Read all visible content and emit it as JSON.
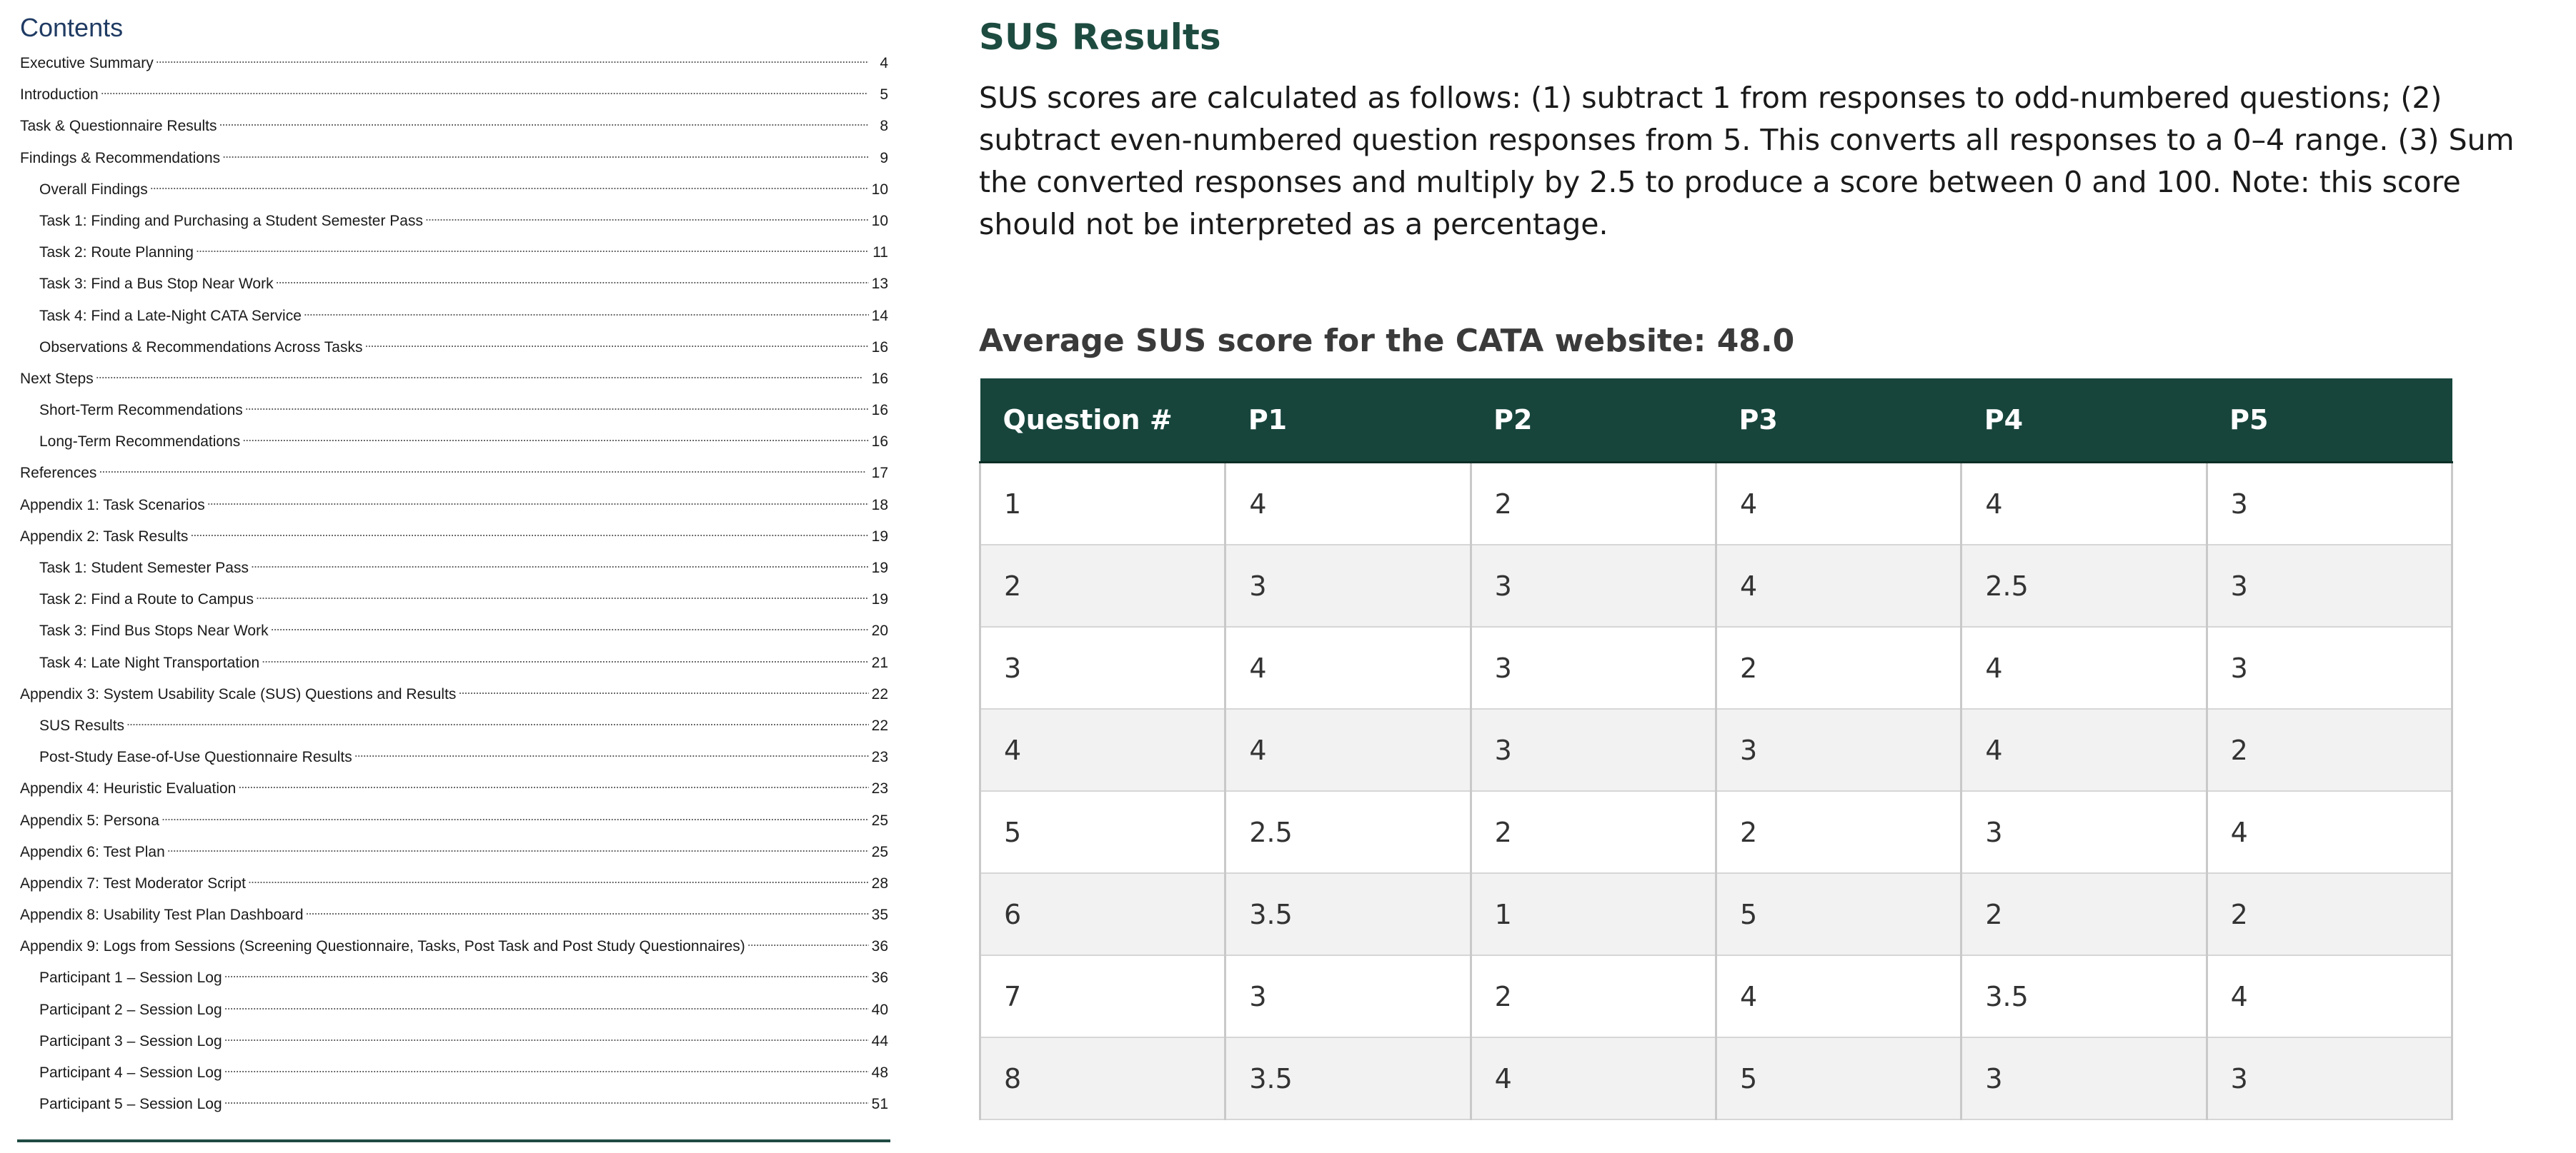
{
  "toc": {
    "heading": "Contents",
    "entries": [
      {
        "title": "Executive Summary",
        "page": "4",
        "level": 1
      },
      {
        "title": "Introduction",
        "page": "5",
        "level": 1
      },
      {
        "title": "Task & Questionnaire Results",
        "page": "8",
        "level": 1
      },
      {
        "title": "Findings & Recommendations",
        "page": "9",
        "level": 1
      },
      {
        "title": "Overall Findings",
        "page": "10",
        "level": 2
      },
      {
        "title": "Task 1: Finding and Purchasing a Student Semester Pass",
        "page": "10",
        "level": 2
      },
      {
        "title": "Task 2: Route Planning",
        "page": "11",
        "level": 2
      },
      {
        "title": "Task 3: Find a Bus Stop Near Work",
        "page": "13",
        "level": 2
      },
      {
        "title": "Task 4: Find a Late-Night CATA Service",
        "page": "14",
        "level": 2
      },
      {
        "title": "Observations & Recommendations Across Tasks",
        "page": "16",
        "level": 2
      },
      {
        "title": "Next Steps",
        "page": "16",
        "level": 1
      },
      {
        "title": "Short-Term Recommendations",
        "page": "16",
        "level": 2
      },
      {
        "title": "Long-Term Recommendations",
        "page": "16",
        "level": 2
      },
      {
        "title": "References",
        "page": "17",
        "level": 1
      },
      {
        "title": "Appendix 1: Task Scenarios",
        "page": "18",
        "level": 1
      },
      {
        "title": "Appendix 2: Task Results",
        "page": "19",
        "level": 1
      },
      {
        "title": "Task 1: Student Semester Pass",
        "page": "19",
        "level": 2
      },
      {
        "title": "Task 2: Find a Route to Campus",
        "page": "19",
        "level": 2
      },
      {
        "title": "Task 3: Find Bus Stops Near Work",
        "page": "20",
        "level": 2
      },
      {
        "title": "Task 4: Late Night Transportation",
        "page": "21",
        "level": 2
      },
      {
        "title": "Appendix 3: System Usability Scale (SUS) Questions and Results",
        "page": "22",
        "level": 1
      },
      {
        "title": "SUS Results",
        "page": "22",
        "level": 2
      },
      {
        "title": "Post-Study Ease-of-Use Questionnaire Results",
        "page": "23",
        "level": 2
      },
      {
        "title": "Appendix 4: Heuristic Evaluation",
        "page": "23",
        "level": 1
      },
      {
        "title": "Appendix 5: Persona",
        "page": "25",
        "level": 1
      },
      {
        "title": "Appendix 6: Test Plan",
        "page": "25",
        "level": 1
      },
      {
        "title": "Appendix 7: Test Moderator Script",
        "page": "28",
        "level": 1
      },
      {
        "title": "Appendix 8: Usability Test Plan Dashboard",
        "page": "35",
        "level": 1
      },
      {
        "title": "Appendix 9: Logs from Sessions (Screening Questionnaire, Tasks, Post Task and Post Study Questionnaires)",
        "page": "36",
        "level": 1
      },
      {
        "title": "Participant 1 – Session Log",
        "page": "36",
        "level": 2
      },
      {
        "title": "Participant 2 – Session Log",
        "page": "40",
        "level": 2
      },
      {
        "title": "Participant 3 – Session Log",
        "page": "44",
        "level": 2
      },
      {
        "title": "Participant 4 – Session Log",
        "page": "48",
        "level": 2
      },
      {
        "title": "Participant 5 – Session Log",
        "page": "51",
        "level": 2
      }
    ]
  },
  "section": {
    "title": "SUS Results",
    "body": "SUS scores are calculated as follows: (1) subtract 1 from responses to odd-numbered questions; (2) subtract even-numbered question responses from 5. This converts all responses to a 0–4 range. (3) Sum the converted responses and multiply by 2.5 to produce a score between 0 and 100. Note: this score should not be interpreted as a percentage.",
    "average_heading": "Average SUS score for the CATA website: 48.0"
  },
  "sus_table": {
    "headers": [
      "Question #",
      "P1",
      "P2",
      "P3",
      "P4",
      "P5"
    ],
    "rows": [
      [
        "1",
        "4",
        "2",
        "4",
        "4",
        "3"
      ],
      [
        "2",
        "3",
        "3",
        "4",
        "2.5",
        "3"
      ],
      [
        "3",
        "4",
        "3",
        "2",
        "4",
        "3"
      ],
      [
        "4",
        "4",
        "3",
        "3",
        "4",
        "2"
      ],
      [
        "5",
        "2.5",
        "2",
        "2",
        "3",
        "4"
      ],
      [
        "6",
        "3.5",
        "1",
        "5",
        "2",
        "2"
      ],
      [
        "7",
        "3",
        "2",
        "4",
        "3.5",
        "4"
      ],
      [
        "8",
        "3.5",
        "4",
        "5",
        "3",
        "3"
      ]
    ]
  },
  "colors": {
    "toc_heading": "#1f3b63",
    "section_title": "#1d4b40",
    "table_header_bg": "#17453c",
    "table_header_text": "#ffffff",
    "row_alt_bg": "#f2f2f2"
  }
}
